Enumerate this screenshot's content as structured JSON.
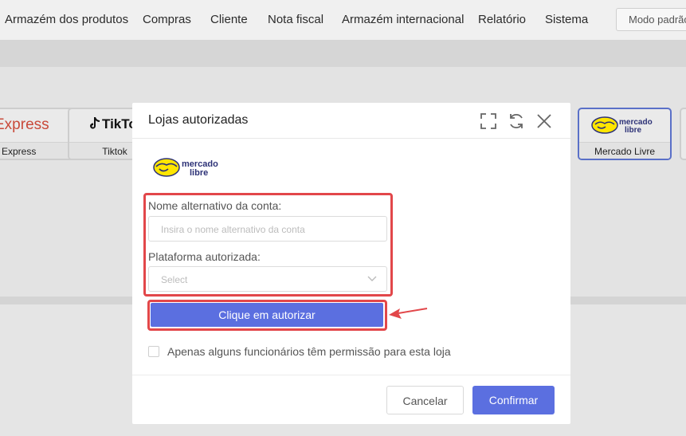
{
  "nav": {
    "items": [
      "Armazém dos produtos",
      "Compras",
      "Cliente",
      "Nota fiscal",
      "Armazém internacional",
      "Relatório",
      "Sistema"
    ],
    "mode_label": "Modo padrão"
  },
  "platforms": [
    {
      "logo_text": "Express",
      "label": "Express",
      "selected": false
    },
    {
      "logo_text": "TikTo",
      "label": "Tiktok",
      "selected": false
    },
    {
      "logo_text": "mercado libre",
      "label": "Mercado Livre",
      "selected": true
    }
  ],
  "modal": {
    "title": "Lojas autorizadas",
    "logo_text_1": "mercado",
    "logo_text_2": "libre",
    "account_label": "Nome alternativo da conta:",
    "account_placeholder": "Insira o nome alternativo da conta",
    "platform_label": "Plataforma autorizada:",
    "platform_placeholder": "Select",
    "authorize_button": "Clique em autorizar",
    "checkbox_label": "Apenas alguns funcionários têm permissão para esta loja",
    "checkbox_checked": false,
    "cancel_button": "Cancelar",
    "confirm_button": "Confirmar"
  },
  "icons": {
    "expand": "expand-icon",
    "refresh": "refresh-icon",
    "close": "close-icon",
    "dropdown": "chevron-down-icon"
  },
  "colors": {
    "primary": "#5b6fe0",
    "highlight": "#e2474a",
    "mercado_yellow": "#ffe600",
    "mercado_blue": "#2d3277"
  }
}
